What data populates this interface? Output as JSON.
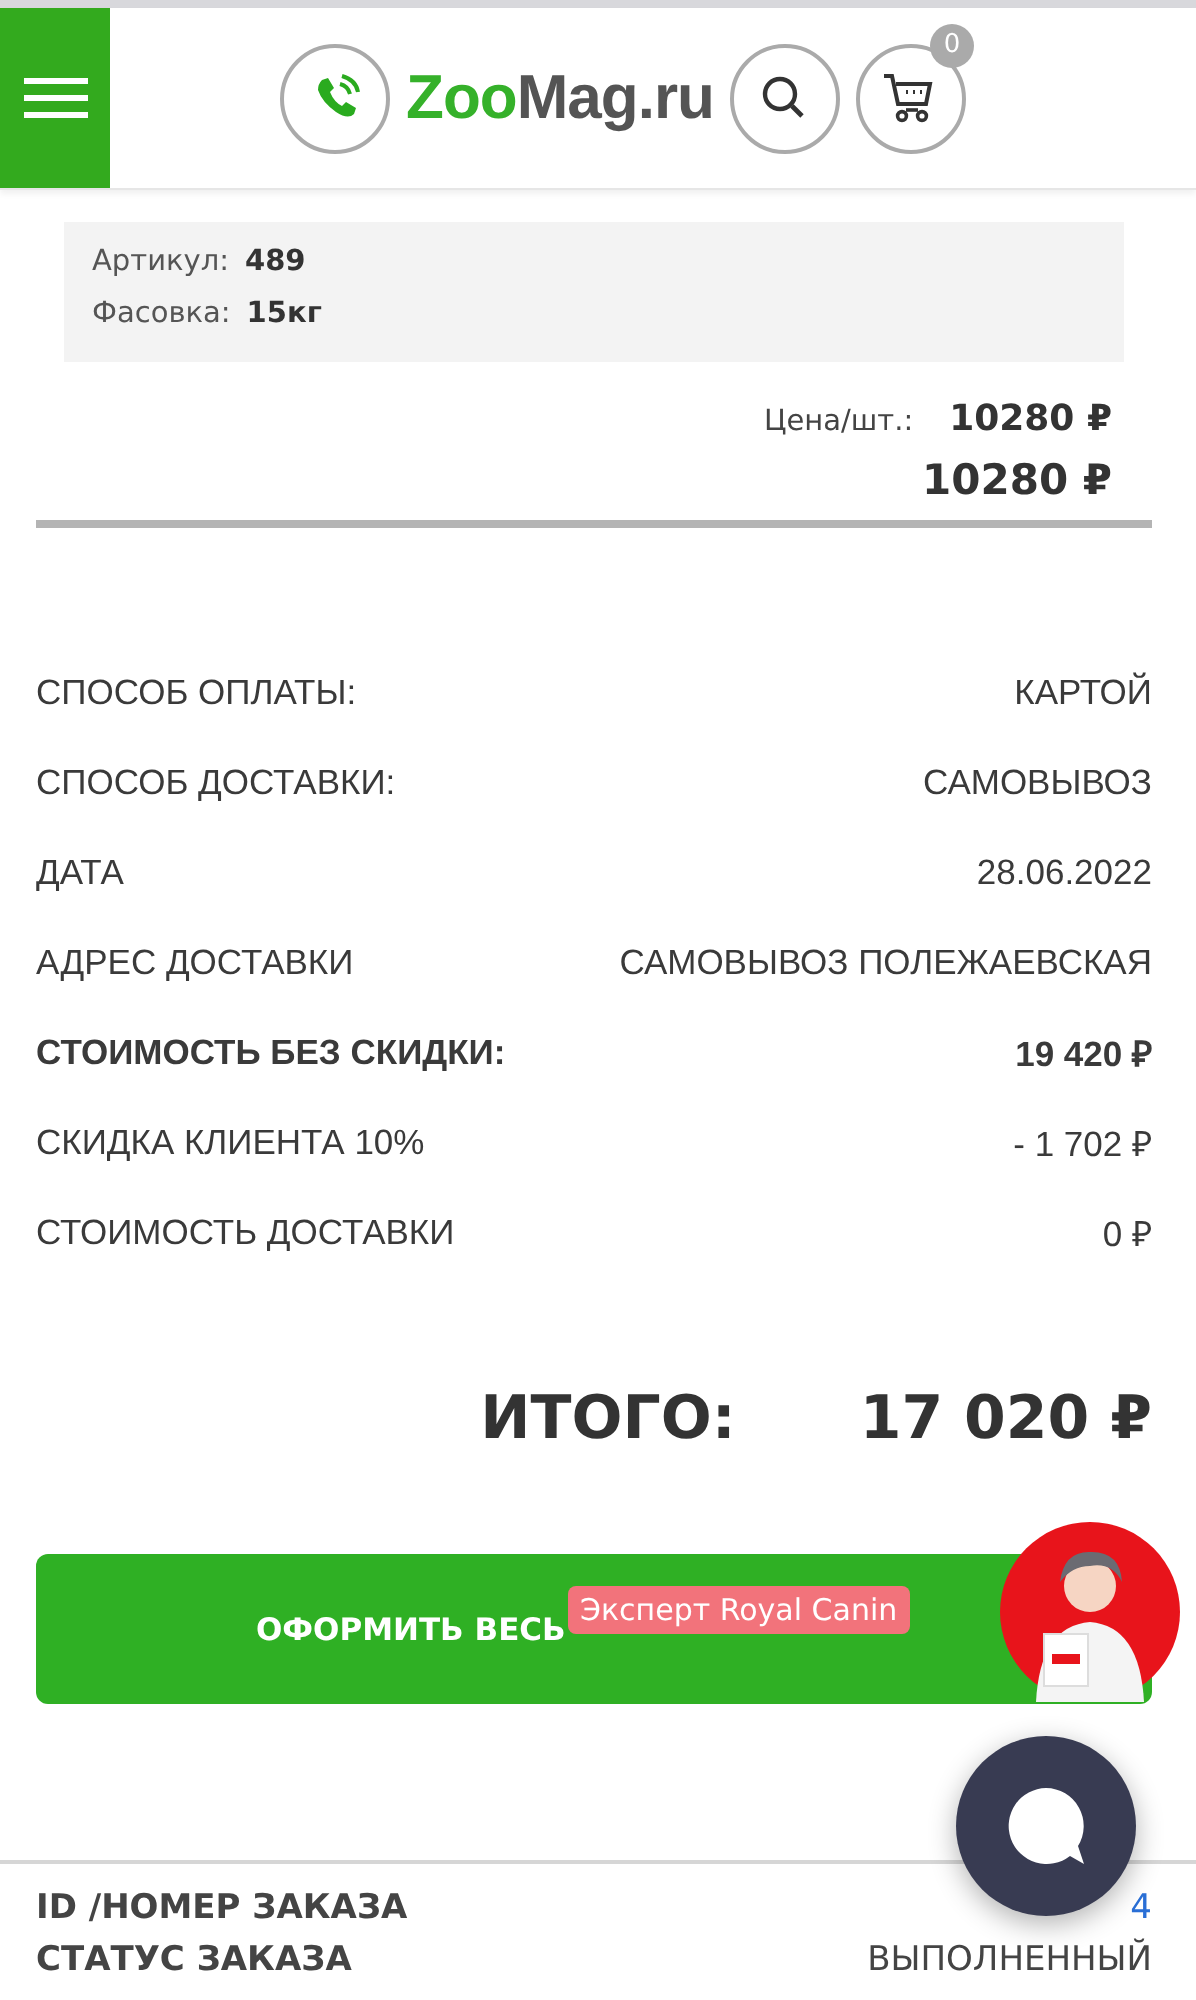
{
  "header": {
    "logo": {
      "part_1": "Zoo",
      "part_2": "Mag.ru"
    },
    "cart_count": "0"
  },
  "product": {
    "specs": [
      {
        "label": "Артикул:",
        "value": "489"
      },
      {
        "label": "Фасовка:",
        "value": "15кг"
      }
    ],
    "price_label": "Цена/шт.:",
    "price": "10280 ₽",
    "total": "10280 ₽"
  },
  "summary": [
    {
      "label": "СПОСОБ ОПЛАТЫ:",
      "value": "КАРТОЙ",
      "bold": false
    },
    {
      "label": "СПОСОБ ДОСТАВКИ:",
      "value": "САМОВЫВОЗ",
      "bold": false
    },
    {
      "label": "ДАТА",
      "value": "28.06.2022",
      "bold": false
    },
    {
      "label": "АДРЕС ДОСТАВКИ",
      "value": "САМОВЫВОЗ ПОЛЕЖАЕВСКАЯ",
      "bold": false
    },
    {
      "label": "СТОИМОСТЬ БЕЗ СКИДКИ:",
      "value": "19 420 ₽",
      "bold": true
    },
    {
      "label": "СКИДКА КЛИЕНТА 10%",
      "value": "- 1 702 ₽",
      "bold": false
    },
    {
      "label": "СТОИМОСТЬ ДОСТАВКИ",
      "value": "0 ₽",
      "bold": false
    }
  ],
  "grand_total": {
    "label": "ИТОГО:",
    "value": "17 020 ₽"
  },
  "reorder_button": "ОФОРМИТЬ ВЕСЬ",
  "expert_tooltip": "Эксперт Royal Canin",
  "order_info": [
    {
      "label": "ID /НОМЕР ЗАКАЗА",
      "value": "4",
      "kind": "link"
    },
    {
      "label": "СТАТУС ЗАКАЗА",
      "value": "ВЫПОЛНЕННЫЙ",
      "kind": "text"
    }
  ]
}
